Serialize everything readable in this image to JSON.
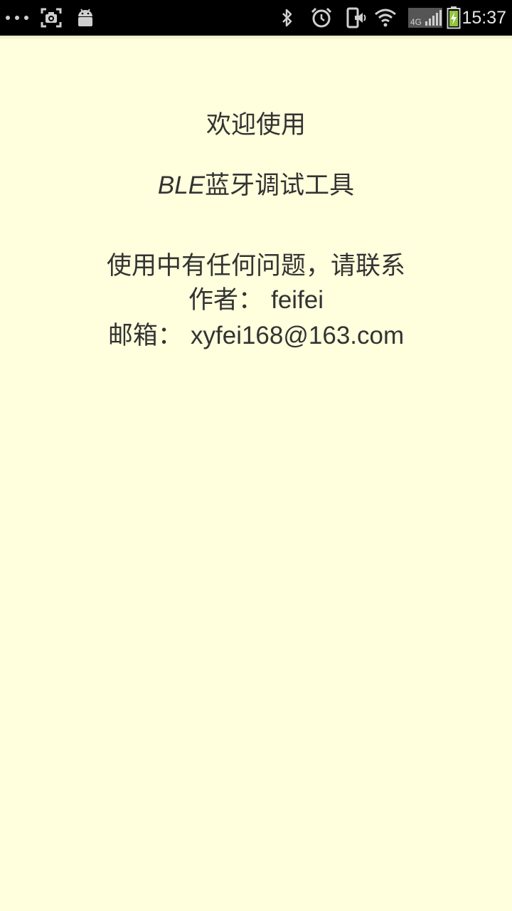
{
  "status_bar": {
    "time": "15:37",
    "network_type": "4G",
    "icons": [
      "more-dots-icon",
      "screenshot-icon",
      "android-icon",
      "bluetooth-icon",
      "alarm-icon",
      "vibrate-icon",
      "wifi-icon",
      "cell-signal-icon",
      "battery-charging-icon"
    ]
  },
  "about": {
    "welcome": "欢迎使用",
    "app_brand": "BLE",
    "app_title": "蓝牙调试工具",
    "contact_prompt": "使用中有任何问题，请联系",
    "author_label": "作者：",
    "author_name": "feifei",
    "email_label": "邮箱：",
    "email": "xyfei168@163.com"
  },
  "colors": {
    "background": "#ffffdd",
    "status_bar": "#000000",
    "text": "#333333"
  }
}
